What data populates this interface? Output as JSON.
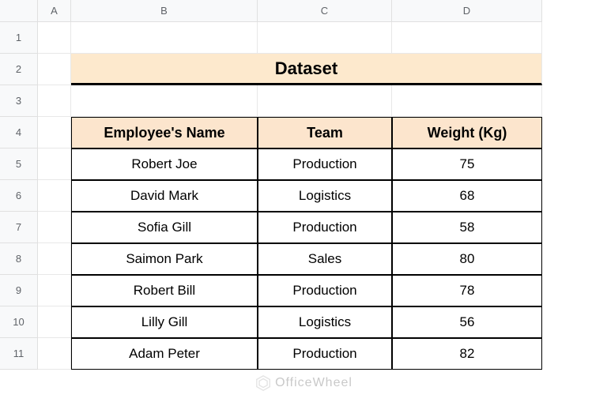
{
  "columns": [
    "A",
    "B",
    "C",
    "D"
  ],
  "rows": [
    "1",
    "2",
    "3",
    "4",
    "5",
    "6",
    "7",
    "8",
    "9",
    "10",
    "11"
  ],
  "title": "Dataset",
  "headers": {
    "name": "Employee's Name",
    "team": "Team",
    "weight": "Weight (Kg)"
  },
  "data": [
    {
      "name": "Robert Joe",
      "team": "Production",
      "weight": "75"
    },
    {
      "name": "David Mark",
      "team": "Logistics",
      "weight": "68"
    },
    {
      "name": "Sofia Gill",
      "team": "Production",
      "weight": "58"
    },
    {
      "name": "Saimon Park",
      "team": "Sales",
      "weight": "80"
    },
    {
      "name": "Robert Bill",
      "team": "Production",
      "weight": "78"
    },
    {
      "name": "Lilly Gill",
      "team": "Logistics",
      "weight": "56"
    },
    {
      "name": "Adam Peter",
      "team": "Production",
      "weight": "82"
    }
  ],
  "watermark": "OfficeWheel"
}
